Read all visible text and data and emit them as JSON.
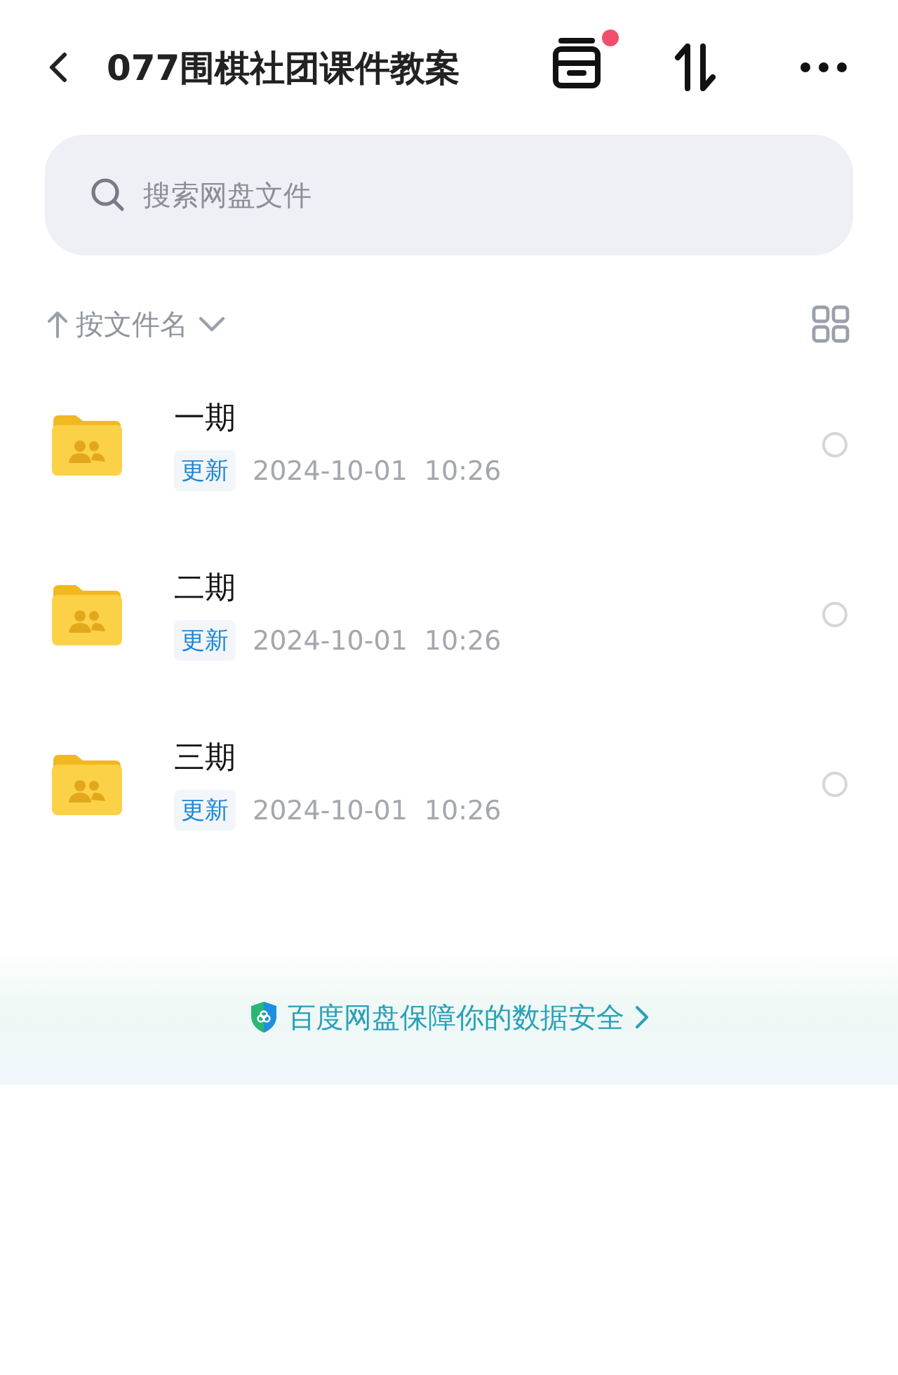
{
  "header": {
    "title": "077围棋社团课件教案"
  },
  "search": {
    "placeholder": "搜索网盘文件"
  },
  "sort": {
    "label": "按文件名"
  },
  "files": [
    {
      "name": "一期",
      "tag": "更新",
      "date": "2024-10-01",
      "time": "10:26",
      "selected": false
    },
    {
      "name": "二期",
      "tag": "更新",
      "date": "2024-10-01",
      "time": "10:26",
      "selected": false
    },
    {
      "name": "三期",
      "tag": "更新",
      "date": "2024-10-01",
      "time": "10:26",
      "selected": false
    }
  ],
  "footer": {
    "text": "百度网盘保障你的数据安全"
  }
}
